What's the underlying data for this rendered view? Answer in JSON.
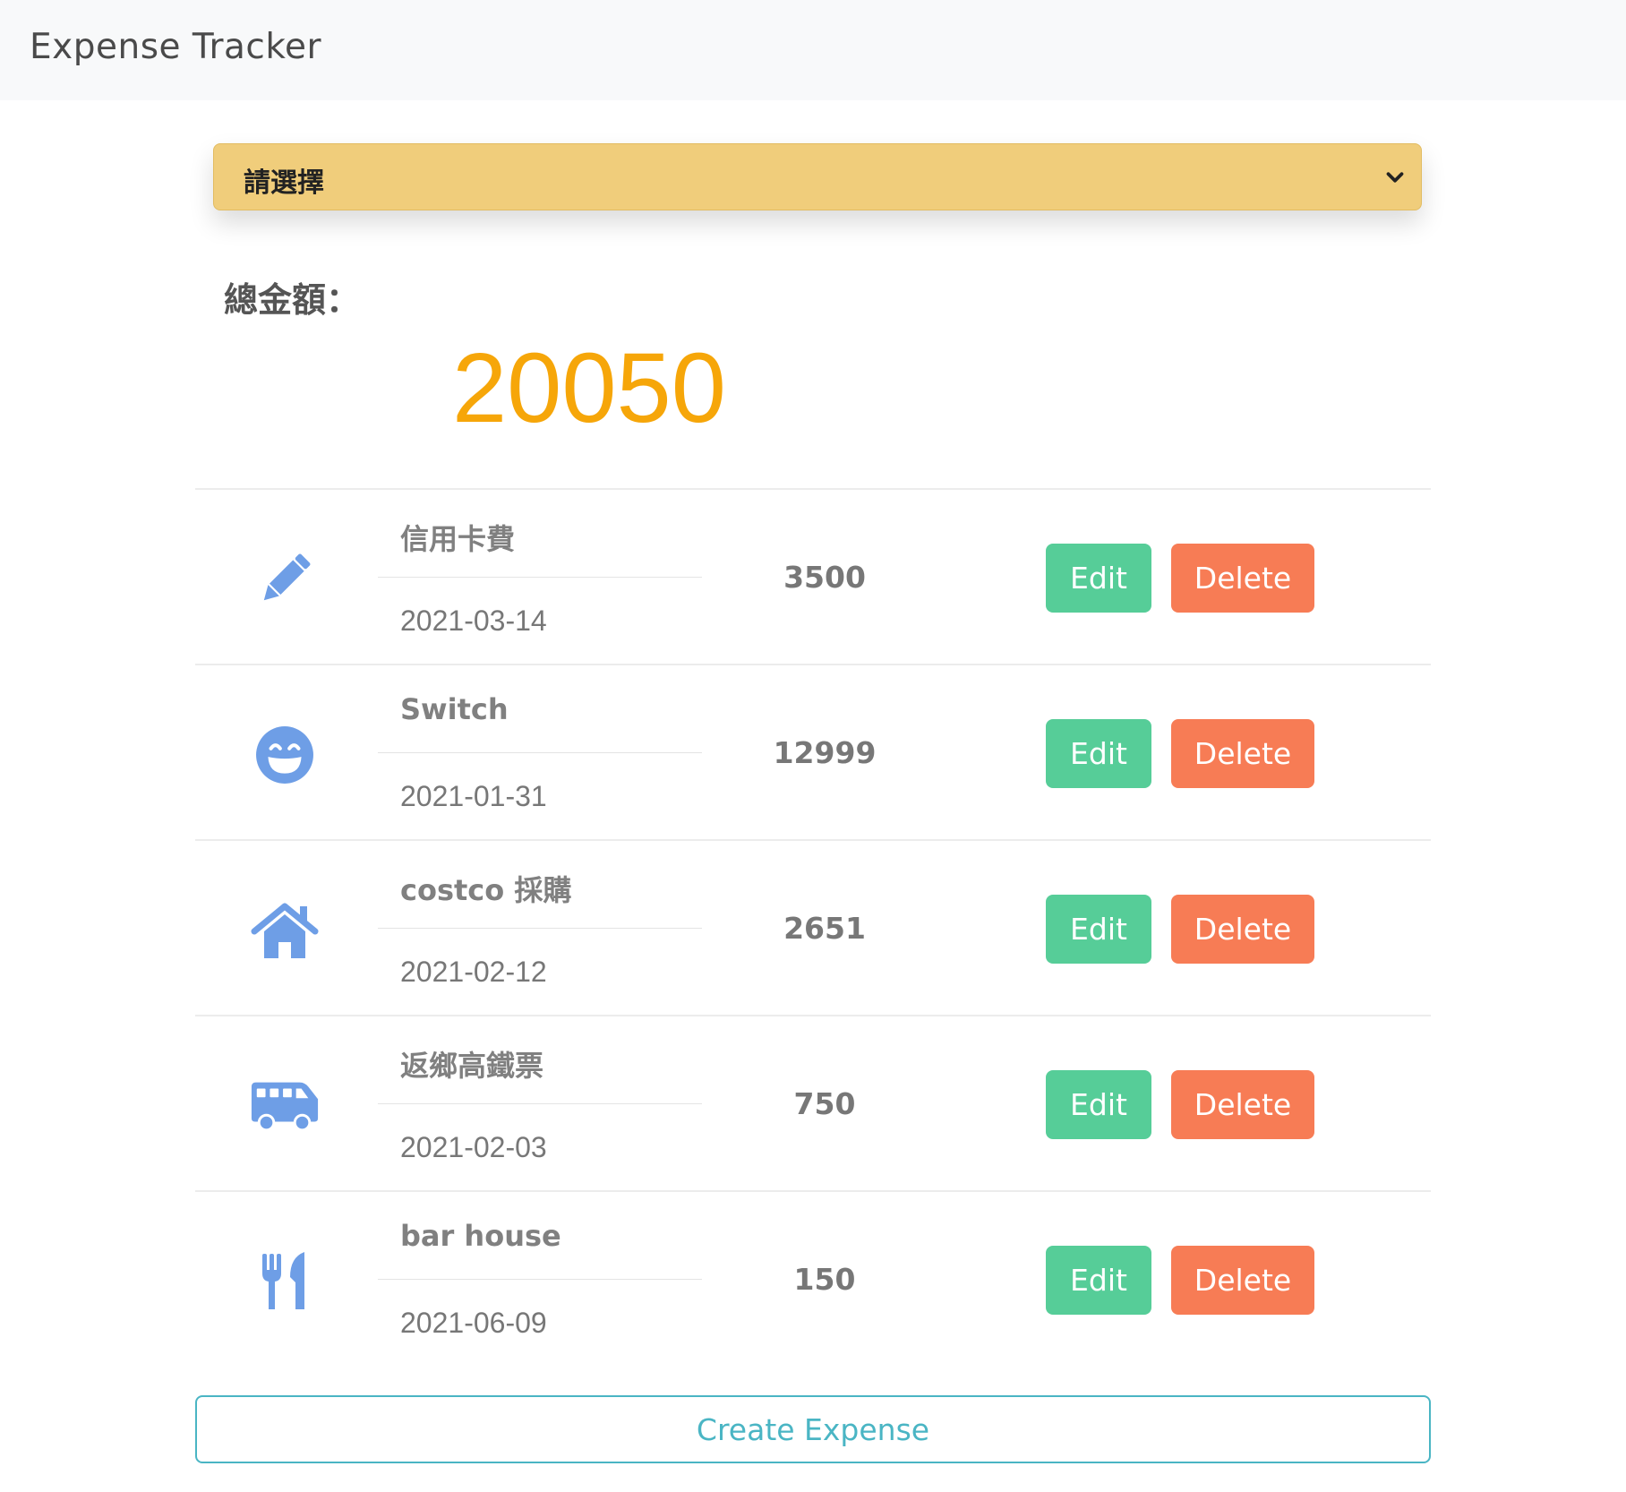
{
  "navbar": {
    "brand": "Expense Tracker"
  },
  "filter": {
    "selected": "請選擇"
  },
  "summary": {
    "label": "總金額：",
    "total": "20050"
  },
  "colors": {
    "icon": "#6e9ee6",
    "edit": "#56cd98",
    "delete": "#f77c55",
    "total": "#f6a609",
    "create": "#4ab5c4",
    "select": "#f0cd7b"
  },
  "expenses": [
    {
      "icon": "pencil-icon",
      "name": "信用卡費",
      "date": "2021-03-14",
      "amount": "3500",
      "edit_label": "Edit",
      "delete_label": "Delete"
    },
    {
      "icon": "grin-icon",
      "name": "Switch",
      "date": "2021-01-31",
      "amount": "12999",
      "edit_label": "Edit",
      "delete_label": "Delete"
    },
    {
      "icon": "home-icon",
      "name": "costco 採購",
      "date": "2021-02-12",
      "amount": "2651",
      "edit_label": "Edit",
      "delete_label": "Delete"
    },
    {
      "icon": "shuttle-van-icon",
      "name": "返鄉高鐵票",
      "date": "2021-02-03",
      "amount": "750",
      "edit_label": "Edit",
      "delete_label": "Delete"
    },
    {
      "icon": "utensils-icon",
      "name": "bar house",
      "date": "2021-06-09",
      "amount": "150",
      "edit_label": "Edit",
      "delete_label": "Delete"
    }
  ],
  "actions": {
    "create_label": "Create Expense"
  }
}
